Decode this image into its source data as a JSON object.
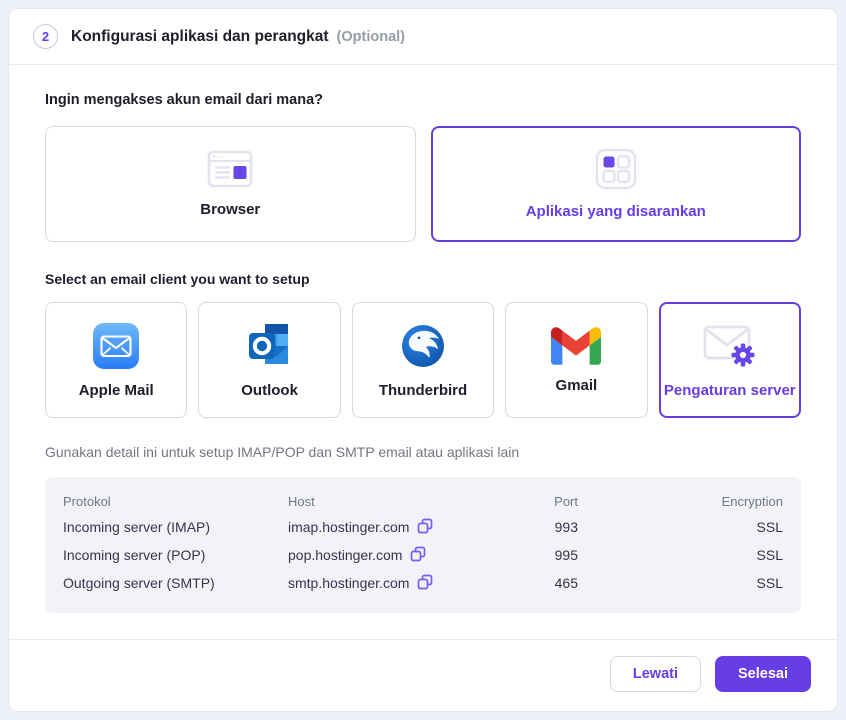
{
  "colors": {
    "accent": "#673de6",
    "page_bg": "#edf0f9",
    "table_bg": "#f2f3f8",
    "muted_text": "#727586",
    "dark_text": "#1d1e2c"
  },
  "header": {
    "step_number": "2",
    "title": "Konfigurasi aplikasi dan perangkat",
    "optional_tag": "(Optional)"
  },
  "access_section": {
    "question": "Ingin mengakses akun email dari mana?",
    "options": [
      {
        "label": "Browser",
        "icon": "browser-window-icon",
        "selected": false
      },
      {
        "label": "Aplikasi yang disarankan",
        "icon": "app-grid-icon",
        "selected": true
      }
    ]
  },
  "client_section": {
    "heading": "Select an email client you want to setup",
    "items": [
      {
        "label": "Apple Mail",
        "icon": "apple-mail-icon",
        "selected": false
      },
      {
        "label": "Outlook",
        "icon": "outlook-icon",
        "selected": false
      },
      {
        "label": "Thunderbird",
        "icon": "thunderbird-icon",
        "selected": false
      },
      {
        "label": "Gmail",
        "icon": "gmail-icon",
        "selected": false
      },
      {
        "label": "Pengaturan server",
        "icon": "mail-settings-icon",
        "selected": true
      }
    ]
  },
  "details_section": {
    "description": "Gunakan detail ini untuk setup IMAP/POP dan SMTP email atau aplikasi lain",
    "table": {
      "columns": {
        "protocol": "Protokol",
        "host": "Host",
        "port": "Port",
        "encryption": "Encryption"
      },
      "rows": [
        {
          "protocol": "Incoming server (IMAP)",
          "host": "imap.hostinger.com",
          "port": "993",
          "encryption": "SSL"
        },
        {
          "protocol": "Incoming server (POP)",
          "host": "pop.hostinger.com",
          "port": "995",
          "encryption": "SSL"
        },
        {
          "protocol": "Outgoing server (SMTP)",
          "host": "smtp.hostinger.com",
          "port": "465",
          "encryption": "SSL"
        }
      ]
    }
  },
  "footer": {
    "skip_label": "Lewati",
    "finish_label": "Selesai"
  }
}
